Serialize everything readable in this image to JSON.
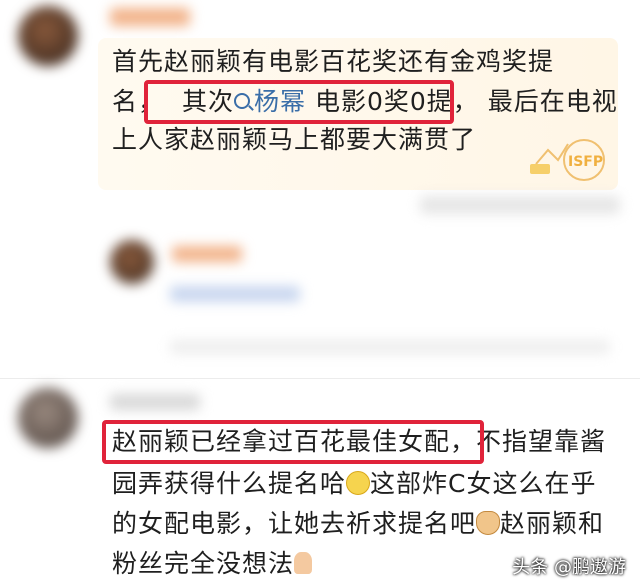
{
  "comment1": {
    "line1": "首先赵丽颖有电影百花奖还有金鸡奖提",
    "line2_prefix": "名，",
    "line2_highlight_a": "其次",
    "mention": "杨幂",
    "line2_highlight_b": " 电影0奖0提，",
    "line2_suffix": " 最后在电视",
    "line3": "上人家赵丽颖马上都要大满贯了",
    "badge_text": "ISFP"
  },
  "comment2": {
    "line1_highlight": "赵丽颖已经拿过百花最佳女配，",
    "line1_suffix": "不指望靠酱",
    "line2": "园弄获得什么提名哈",
    "line2_after_emoji": "这部炸C女这么在乎",
    "line3": "的女配电影，让她去祈求提名吧",
    "line3_after_emoji": "赵丽颖和",
    "line4": "粉丝完全没想法"
  },
  "watermark": "头条 @鹏遨游",
  "colors": {
    "highlight_border": "#e0233a",
    "mention": "#3a6ea8",
    "bubble_bg": "#fff8ec"
  }
}
